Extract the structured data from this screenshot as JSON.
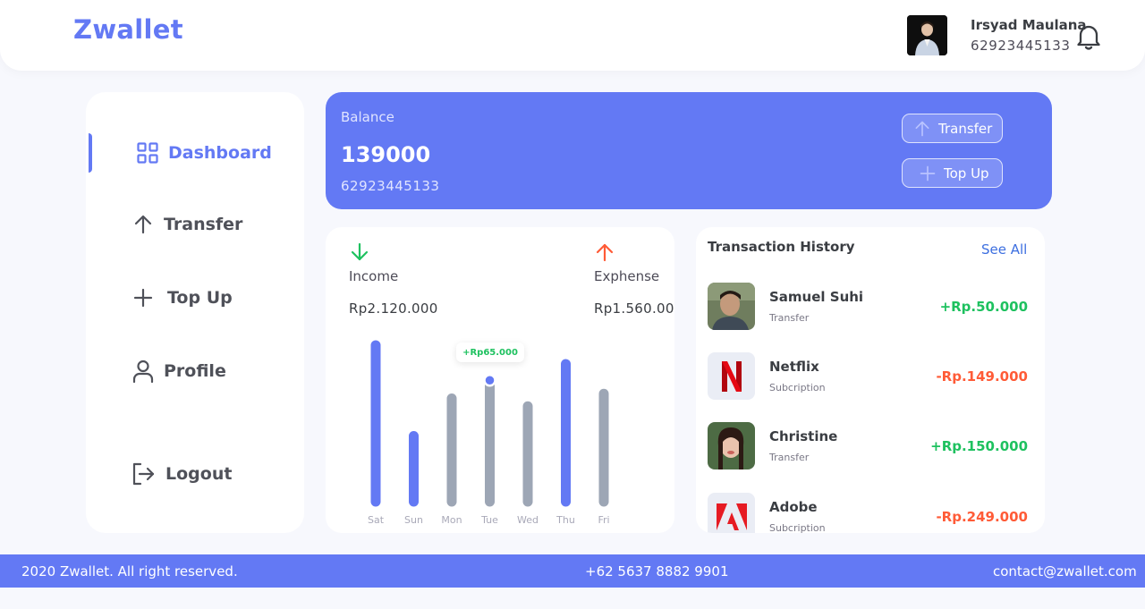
{
  "header": {
    "logo": "Zwallet",
    "user_name": "Irsyad Maulana",
    "user_phone": "62923445133"
  },
  "sidebar": {
    "items": [
      {
        "label": "Dashboard",
        "icon": "grid-icon",
        "active": true
      },
      {
        "label": "Transfer",
        "icon": "arrow-up-icon"
      },
      {
        "label": "Top Up",
        "icon": "plus-icon"
      },
      {
        "label": "Profile",
        "icon": "user-icon"
      }
    ],
    "logout_label": "Logout"
  },
  "balance": {
    "label": "Balance",
    "amount": "139000",
    "phone": "62923445133",
    "transfer_label": "Transfer",
    "topup_label": "Top Up"
  },
  "stats": {
    "income_label": "Income",
    "income_value": "Rp2.120.000",
    "expense_label": "Exphense",
    "expense_value": "Rp1.560.00"
  },
  "chart_data": {
    "type": "bar",
    "categories": [
      "Sat",
      "Sun",
      "Mon",
      "Tue",
      "Wed",
      "Thu",
      "Fri"
    ],
    "values": [
      100,
      42,
      66,
      77,
      61,
      88,
      69
    ],
    "colors": [
      "#6379f4",
      "#6379f4",
      "#9da6b5",
      "#9da6b5",
      "#9da6b5",
      "#6379f4",
      "#9da6b5"
    ],
    "ylim": [
      0,
      100
    ],
    "highlight_index": 3,
    "tooltip": "+Rp65.000"
  },
  "history": {
    "title": "Transaction History",
    "see_all": "See All",
    "items": [
      {
        "name": "Samuel Suhi",
        "type": "Transfer",
        "amount": "+Rp.50.000",
        "sign": "pos",
        "icon": "avatar-samuel"
      },
      {
        "name": "Netflix",
        "type": "Subcription",
        "amount": "-Rp.149.000",
        "sign": "neg",
        "icon": "netflix-logo-icon"
      },
      {
        "name": "Christine",
        "type": "Transfer",
        "amount": "+Rp.150.000",
        "sign": "pos",
        "icon": "avatar-christine"
      },
      {
        "name": "Adobe",
        "type": "Subcription",
        "amount": "-Rp.249.000",
        "sign": "neg",
        "icon": "adobe-logo-icon"
      }
    ]
  },
  "footer": {
    "copyright": "2020 Zwallet. All right reserved.",
    "phone": "+62 5637 8882 9901",
    "email": "contact@zwallet.com"
  }
}
